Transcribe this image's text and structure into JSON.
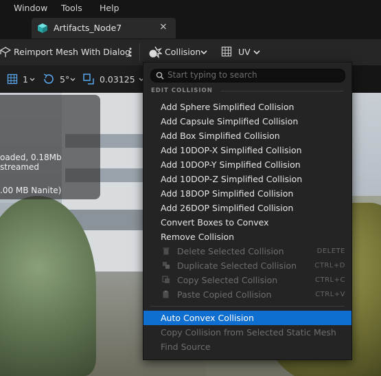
{
  "menubar": {
    "items": [
      "Window",
      "Tools",
      "Help"
    ]
  },
  "tab": {
    "title": "Artifacts_Node7",
    "close": "×"
  },
  "toolbar": {
    "reimport_label": "Reimport Mesh With Dialog",
    "collision_label": "Collision",
    "uv_label": "UV"
  },
  "viewport_bar": {
    "grid_value": "1",
    "rotation_value": "5°",
    "scale_value": "0.03125"
  },
  "viewport": {
    "stats_line1": "oaded, 0.18Mb streamed",
    "stats_line2": ".00 MB Nanite)"
  },
  "dropdown": {
    "search_placeholder": "Start typing to search",
    "section_header": "EDIT COLLISION",
    "items": [
      {
        "label": "Add Sphere Simplified Collision"
      },
      {
        "label": "Add Capsule Simplified Collision"
      },
      {
        "label": "Add Box Simplified Collision"
      },
      {
        "label": "Add 10DOP-X Simplified Collision"
      },
      {
        "label": "Add 10DOP-Y Simplified Collision"
      },
      {
        "label": "Add 10DOP-Z Simplified Collision"
      },
      {
        "label": "Add 18DOP Simplified Collision"
      },
      {
        "label": "Add 26DOP Simplified Collision"
      },
      {
        "label": "Convert Boxes to Convex"
      },
      {
        "label": "Remove Collision"
      },
      {
        "label": "Delete Selected Collision",
        "shortcut": "DELETE"
      },
      {
        "label": "Duplicate Selected Collision",
        "shortcut": "CTRL+D"
      },
      {
        "label": "Copy Selected Collision",
        "shortcut": "CTRL+C"
      },
      {
        "label": "Paste Copied Collision",
        "shortcut": "CTRL+V"
      },
      {
        "label": "Auto Convex Collision"
      },
      {
        "label": "Copy Collision from Selected Static Mesh"
      },
      {
        "label": "Find Source"
      }
    ]
  },
  "colors": {
    "highlight": "#0e6fd0",
    "tab_icon": "#3fc6c6"
  }
}
